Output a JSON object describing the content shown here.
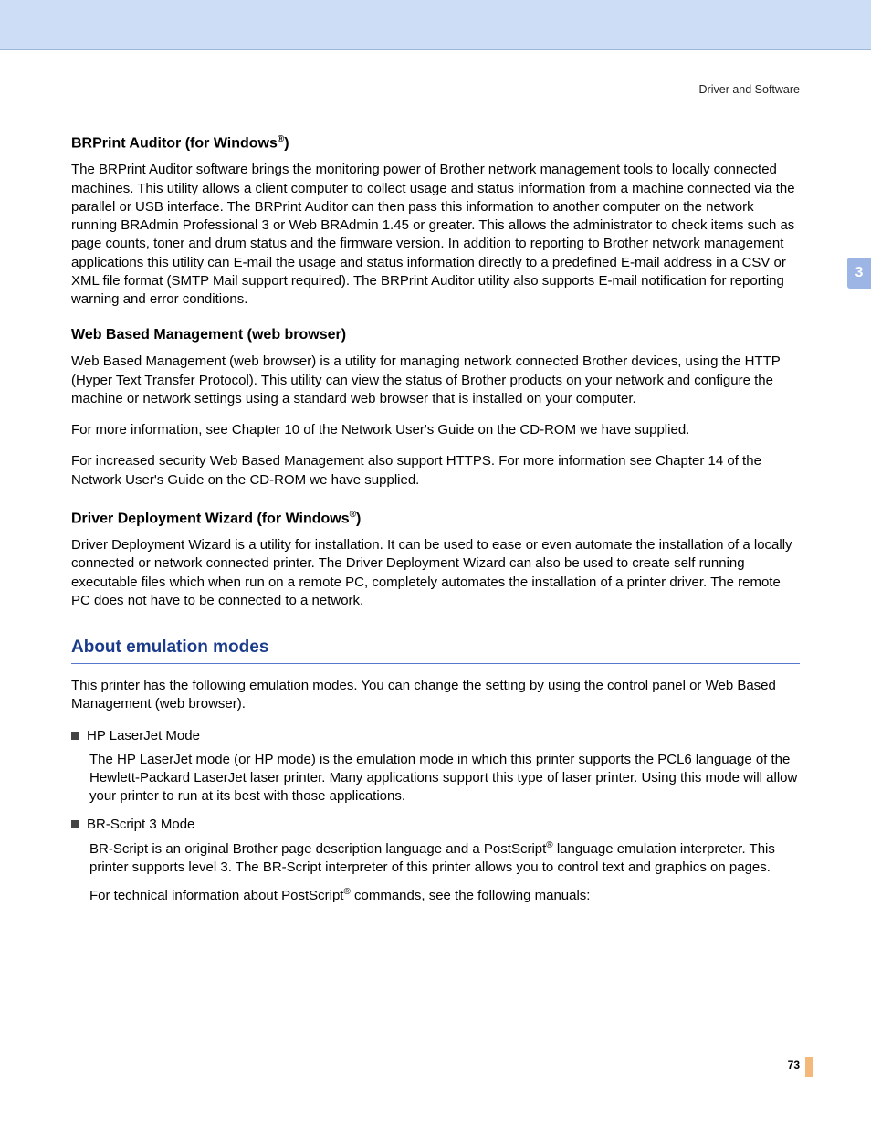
{
  "running_header": "Driver and Software",
  "chapter_tab": "3",
  "sections": {
    "brprint": {
      "heading": "BRPrint Auditor (for Windows",
      "heading_sup": "®",
      "heading_close": ")",
      "p1": "The BRPrint Auditor software brings the monitoring power of Brother network management tools to locally connected machines. This utility allows a client computer to collect usage and status information from a machine connected via the parallel or USB interface. The BRPrint Auditor can then pass this information to another computer on the network running BRAdmin Professional 3 or Web BRAdmin 1.45 or greater. This allows the administrator to check items such as page counts, toner and drum status and the firmware version. In addition to reporting to Brother network management applications this utility can E-mail the usage and status information directly to a predefined E-mail address in a CSV or XML file format (SMTP Mail support required). The BRPrint Auditor utility also supports E-mail notification for reporting warning and error conditions."
    },
    "web": {
      "heading": "Web Based Management (web browser)",
      "p1": "Web Based Management (web browser) is a utility for managing network connected Brother devices, using the HTTP (Hyper Text Transfer Protocol). This utility can view the status of Brother products on your network and configure the machine or network settings using a standard web browser that is installed on your computer.",
      "p2": "For more information, see Chapter 10 of the Network User's Guide on the CD-ROM we have supplied.",
      "p3": "For increased security Web Based Management also support HTTPS. For more information see Chapter 14 of the Network User's Guide on the CD-ROM we have supplied."
    },
    "driver": {
      "heading": "Driver Deployment Wizard (for Windows",
      "heading_sup": "®",
      "heading_close": ")",
      "p1": "Driver Deployment Wizard is a utility for installation. It can be used to ease or even automate the installation of a locally connected or network connected printer. The Driver Deployment Wizard can also be used to create self running executable files which when run on a remote PC, completely automates the installation of a printer driver. The remote PC does not have to be connected to a network."
    },
    "emulation": {
      "heading": "About emulation modes",
      "intro": "This printer has the following emulation modes. You can change the setting by using the control panel or Web Based Management (web browser).",
      "b1_title": "HP LaserJet Mode",
      "b1_body": "The HP LaserJet mode (or HP mode) is the emulation mode in which this printer supports the PCL6 language of the Hewlett-Packard LaserJet laser printer. Many applications support this type of laser printer. Using this mode will allow your printer to run at its best with those applications.",
      "b2_title": "BR-Script 3 Mode",
      "b2_body_pre": "BR-Script is an original Brother page description language and a PostScript",
      "b2_body_sup": "®",
      "b2_body_post": " language emulation interpreter. This printer supports level 3. The BR-Script interpreter of this printer allows you to control text and graphics on pages.",
      "b2_note_pre": "For technical information about PostScript",
      "b2_note_sup": "®",
      "b2_note_post": " commands, see the following manuals:"
    }
  },
  "page_number": "73"
}
